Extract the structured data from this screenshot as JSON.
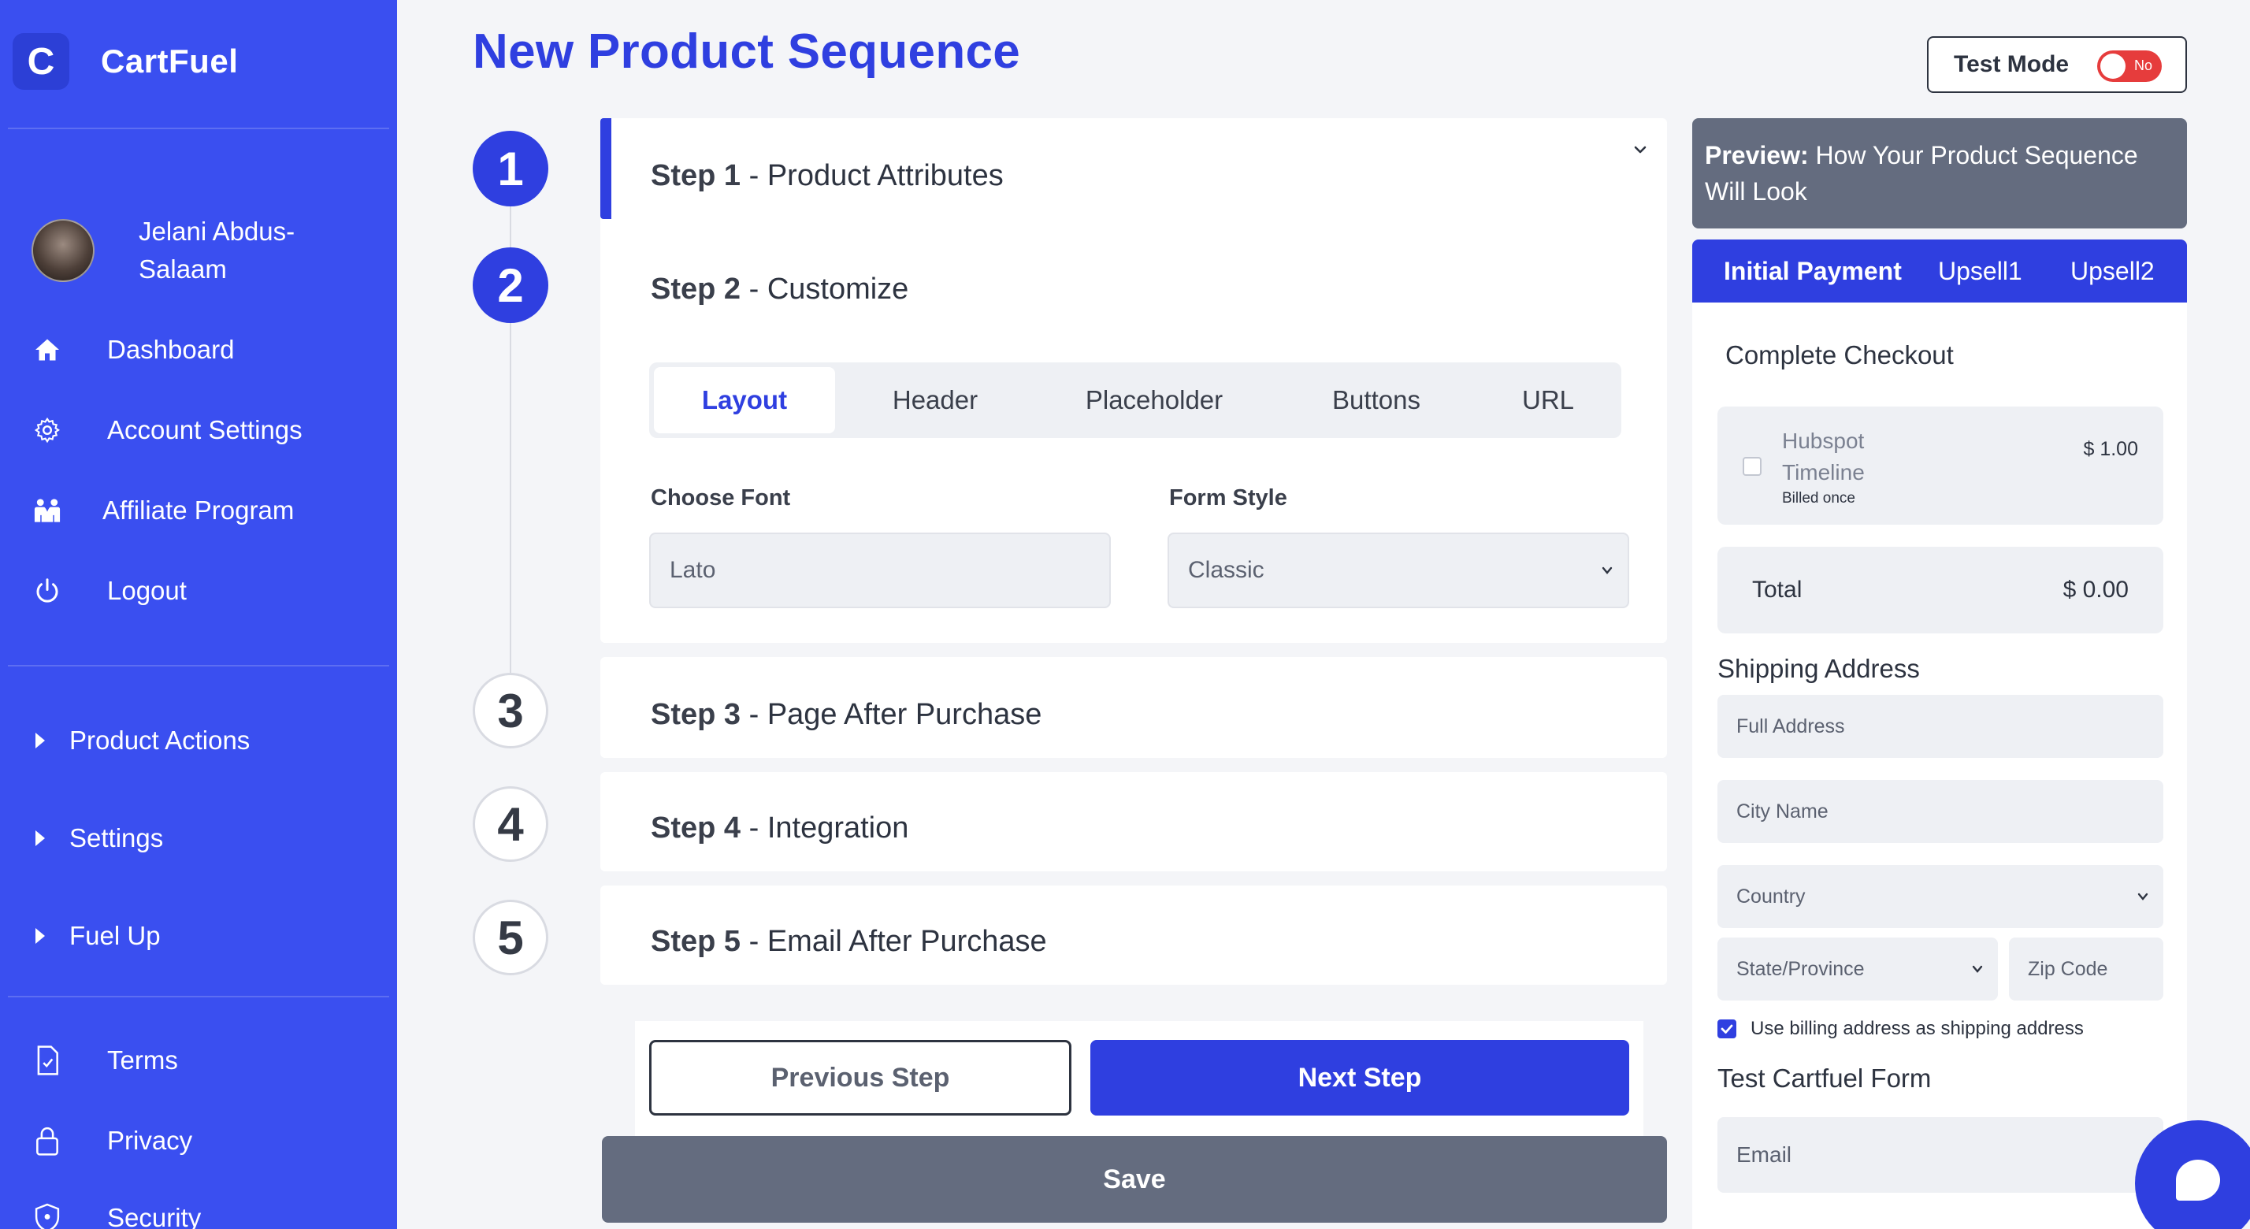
{
  "brand": {
    "logo_letter": "C",
    "name": "CartFuel"
  },
  "user": {
    "name": "Jelani Abdus-Salaam"
  },
  "sidebar": {
    "main_items": [
      {
        "label": "Dashboard",
        "icon": "home-icon"
      },
      {
        "label": "Account Settings",
        "icon": "gear-icon"
      },
      {
        "label": "Affiliate Program",
        "icon": "people-icon"
      },
      {
        "label": "Logout",
        "icon": "power-icon"
      }
    ],
    "groups": [
      {
        "label": "Product Actions"
      },
      {
        "label": "Settings"
      },
      {
        "label": "Fuel Up"
      }
    ],
    "footer_items": [
      {
        "label": "Terms",
        "icon": "document-icon"
      },
      {
        "label": "Privacy",
        "icon": "lock-icon"
      },
      {
        "label": "Security",
        "icon": "shield-icon"
      }
    ]
  },
  "header": {
    "title": "New Product Sequence",
    "test_mode_label": "Test Mode",
    "test_mode_value": "No"
  },
  "steps": [
    {
      "number": "1",
      "bold": "Step 1",
      "rest": " - Product Attributes"
    },
    {
      "number": "2",
      "bold": "Step 2",
      "rest": " - Customize"
    },
    {
      "number": "3",
      "bold": "Step 3",
      "rest": " - Page After Purchase"
    },
    {
      "number": "4",
      "bold": "Step 4",
      "rest": " - Integration"
    },
    {
      "number": "5",
      "bold": "Step 5",
      "rest": " - Email After Purchase"
    }
  ],
  "customize": {
    "tabs": [
      "Layout",
      "Header",
      "Placeholder",
      "Buttons",
      "URL"
    ],
    "active_tab": "Layout",
    "font_label": "Choose Font",
    "font_value": "Lato",
    "form_style_label": "Form Style",
    "form_style_value": "Classic"
  },
  "actions": {
    "previous": "Previous Step",
    "next": "Next Step",
    "save": "Save"
  },
  "preview": {
    "heading_bold": "Preview:",
    "heading_rest": " How Your Product Sequence Will Look",
    "tabs": [
      "Initial Payment",
      "Upsell1",
      "Upsell2"
    ],
    "checkout_title": "Complete Checkout",
    "product": {
      "name": "Hubspot Timeline",
      "billing": "Billed once",
      "price": "$ 1.00"
    },
    "total_label": "Total",
    "total_value": "$ 0.00",
    "shipping_title": "Shipping Address",
    "full_address_placeholder": "Full Address",
    "city_placeholder": "City Name",
    "country_placeholder": "Country",
    "state_placeholder": "State/Province",
    "zip_placeholder": "Zip Code",
    "use_billing_label": "Use billing address as shipping address",
    "test_form_title": "Test Cartfuel Form",
    "email_placeholder": "Email"
  },
  "colors": {
    "accent": "#2f3fe0",
    "sidebar": "#3a4ff0",
    "muted_button": "#646c7f",
    "toggle_off": "#e63c3c"
  }
}
